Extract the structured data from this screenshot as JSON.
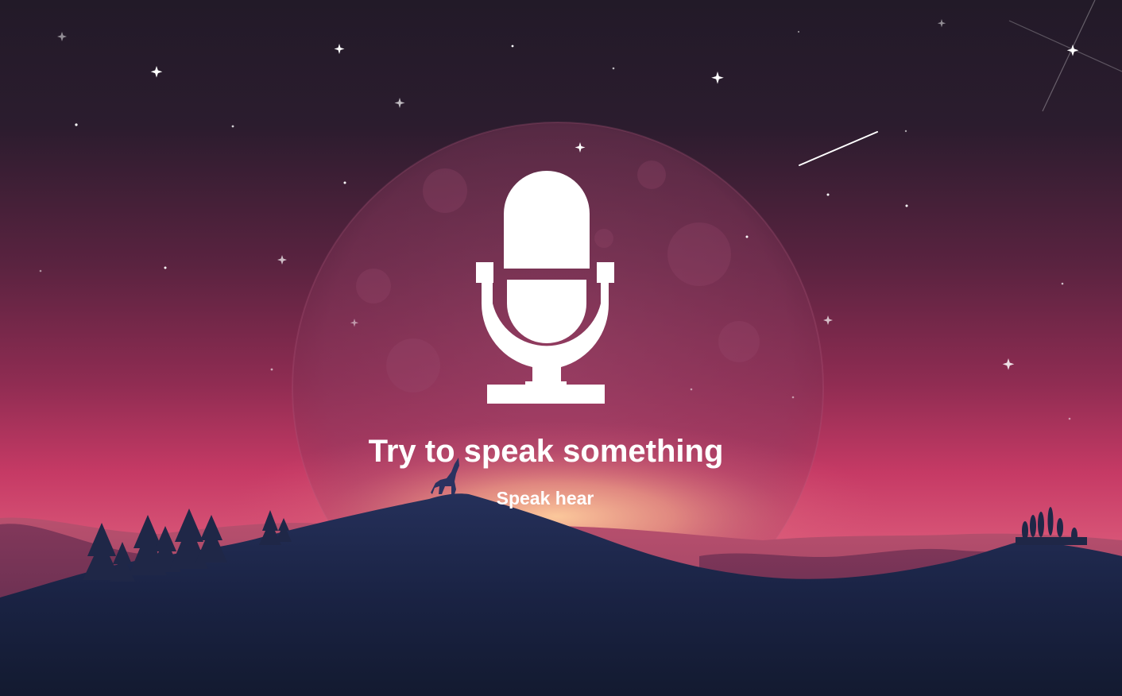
{
  "scene": {
    "background": "night-sky-moon-mountains-wolf",
    "colors": {
      "sky_top": "#221a28",
      "sky_mid": "#7a2a4c",
      "sky_horizon": "#d0416a",
      "glow": "#f6b38e",
      "mountain_dark": "#141b2e",
      "mountain_mid": "#263256",
      "text": "#ffffff"
    }
  },
  "voice": {
    "mic_icon": "microphone-icon",
    "prompt": "Try to speak something",
    "output": "Speak hear"
  }
}
